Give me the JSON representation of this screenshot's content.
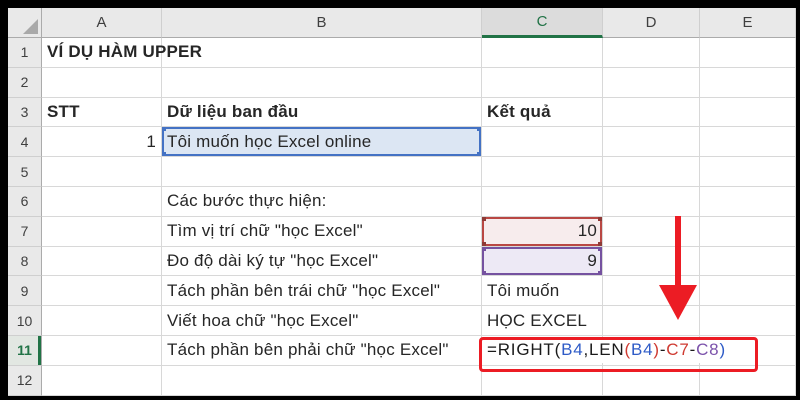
{
  "grid": {
    "column_headers": [
      "A",
      "B",
      "C",
      "D",
      "E"
    ],
    "row_numbers": [
      "1",
      "2",
      "3",
      "4",
      "5",
      "6",
      "7",
      "8",
      "9",
      "10",
      "11",
      "12"
    ],
    "active_column": "C",
    "active_row": "11"
  },
  "cells": {
    "A1": "VÍ DỤ HÀM UPPER",
    "A3": "STT",
    "B3": "Dữ liệu ban đầu",
    "C3": "Kết quả",
    "A4": "1",
    "B4": "Tôi muốn học Excel online",
    "B6": "Các bước thực hiện:",
    "B7": "Tìm vị trí chữ \"học Excel\"",
    "C7": "10",
    "B8": "Đo độ dài ký tự \"học Excel\"",
    "C8": "9",
    "B9": "Tách phần bên trái chữ \"học Excel\"",
    "C9": "Tôi muốn",
    "B10": "Viết hoa chữ \"học Excel\"",
    "C10": "HỌC EXCEL",
    "B11": "Tách phần bên phải chữ \"học Excel\""
  },
  "formula": {
    "cell": "C11",
    "text": "=RIGHT(B4,LEN(B4)-C7-C8)",
    "tokens": [
      {
        "text": "=RIGHT(",
        "color": "#1a1a1a"
      },
      {
        "text": "B4",
        "color": "#2e5bc7"
      },
      {
        "text": ",LEN",
        "color": "#1a1a1a"
      },
      {
        "text": "(",
        "color": "#cf3a31"
      },
      {
        "text": "B4",
        "color": "#2e5bc7"
      },
      {
        "text": ")",
        "color": "#cf3a31"
      },
      {
        "text": "-",
        "color": "#1a1a1a"
      },
      {
        "text": "C7",
        "color": "#cf3a31"
      },
      {
        "text": "-",
        "color": "#1a1a1a"
      },
      {
        "text": "C8",
        "color": "#7b52ab"
      },
      {
        "text": ")",
        "color": "#2e5bc7"
      }
    ]
  },
  "colors": {
    "excel_green": "#217346",
    "ref_blue": "#4472c4",
    "ref_red": "#b94743",
    "ref_purple": "#7552a0",
    "annotation_red": "#ec1c24"
  }
}
